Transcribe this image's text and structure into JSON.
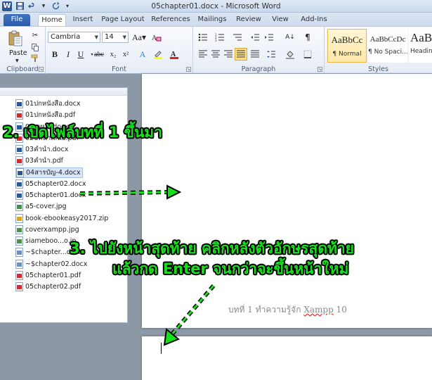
{
  "app": {
    "window_title": "05chapter01.docx - Microsoft Word",
    "logo_letter": "W"
  },
  "tabs": [
    "File",
    "Home",
    "Insert",
    "Page Layout",
    "References",
    "Mailings",
    "Review",
    "View",
    "Add-Ins"
  ],
  "ribbon": {
    "clipboard": {
      "label": "Clipboard",
      "paste_label": "Paste"
    },
    "font": {
      "label": "Font",
      "family": "Cambria",
      "size": "14"
    },
    "paragraph": {
      "label": "Paragraph"
    },
    "styles": {
      "label": "Styles",
      "items": [
        {
          "sample": "AaBbCc",
          "name": "¶ Normal"
        },
        {
          "sample": "AaBbCcDc",
          "name": "¶ No Spaci..."
        },
        {
          "sample": "AaB",
          "name": "Headin"
        }
      ]
    }
  },
  "explorer": {
    "files": [
      {
        "name": "01ปกหนังสือ.docx",
        "type": "word"
      },
      {
        "name": "01ปกหนังสือ.pdf",
        "type": "pdf"
      },
      {
        "name": "02บทนำ.docx",
        "type": "word"
      },
      {
        "name": "02บทนำเสนอ.pdf",
        "type": "pdf"
      },
      {
        "name": "03คำนำ.docx",
        "type": "word"
      },
      {
        "name": "03คำนำ.pdf",
        "type": "pdf"
      },
      {
        "name": "04สารบัญ-4.docx",
        "type": "word",
        "selected": true
      },
      {
        "name": "05chapter02.docx",
        "type": "word"
      },
      {
        "name": "05chapter01.docx",
        "type": "word"
      },
      {
        "name": "a5-cover.jpg",
        "type": "img"
      },
      {
        "name": "book-ebookeasy2017.zip",
        "type": "zip"
      },
      {
        "name": "coverxampp.jpg",
        "type": "img"
      },
      {
        "name": "siameboo...o.jp",
        "type": "img"
      },
      {
        "name": "~$chapter...docx",
        "type": "doc"
      },
      {
        "name": "~$chapter02.docx",
        "type": "doc"
      },
      {
        "name": "05chapter01.pdf",
        "type": "pdf"
      },
      {
        "name": "05chapter02.pdf",
        "type": "pdf"
      }
    ]
  },
  "annotations": {
    "step2": "2. เปิดไฟล์บทที่ 1 ขึ้นมา",
    "step3_line1": "3. ไปยังหน้าสุดท้าย คลิกหลังตัวอักษรสุดท้าย",
    "step3_line2": "แล้วกด Enter จนกว่าจะขึ้นหน้าใหม่"
  },
  "document": {
    "footer_prefix": "บทที่ 1 ทำความรู้จัก ",
    "footer_word": "Xampp",
    "footer_page": " 10"
  },
  "colors": {
    "annotation": "#16e01b",
    "file_tab": "#2b5797"
  }
}
